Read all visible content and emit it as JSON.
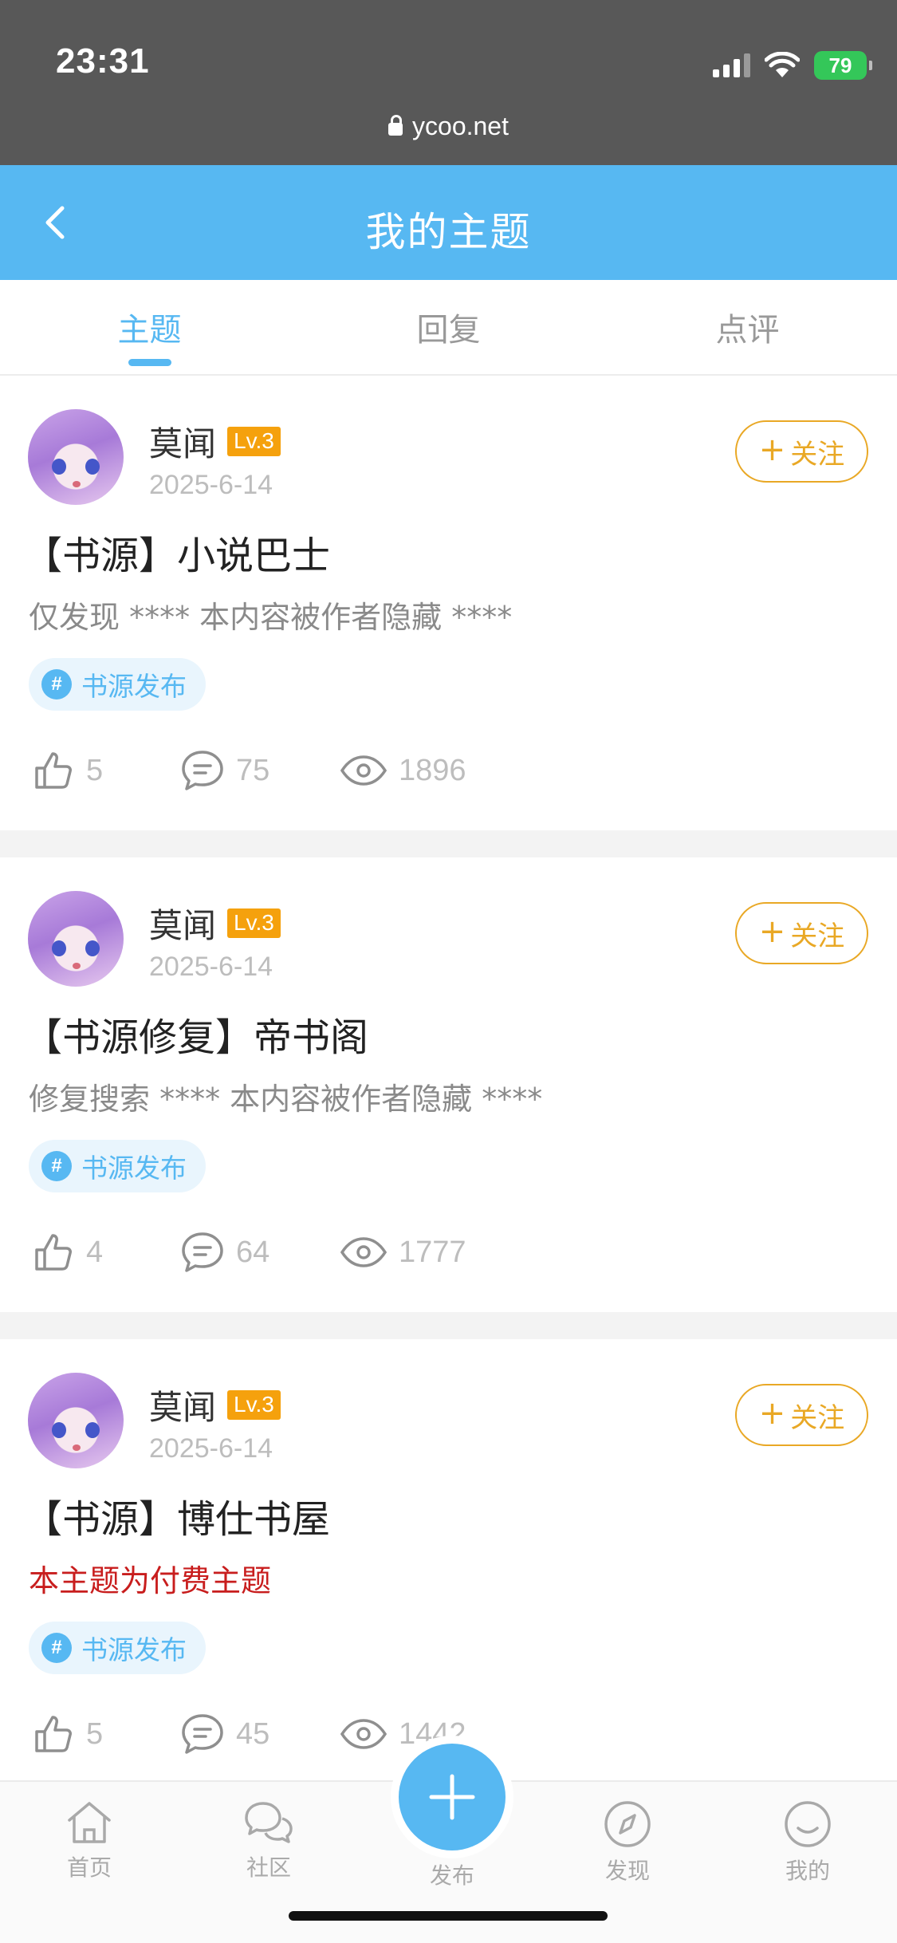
{
  "status_bar": {
    "time": "23:31",
    "battery": "79",
    "url": "ycoo.net"
  },
  "header": {
    "title": "我的主题"
  },
  "tabs": [
    {
      "label": "主题",
      "active": true
    },
    {
      "label": "回复",
      "active": false
    },
    {
      "label": "点评",
      "active": false
    }
  ],
  "posts": [
    {
      "author": "莫闻",
      "level": "Lv.3",
      "date": "2025-6-14",
      "follow_label": "关注",
      "title": "【书源】小说巴士",
      "excerpt": "仅发现 **** 本内容被作者隐藏 ****",
      "excerpt_paid": false,
      "tag": "书源发布",
      "likes": "5",
      "comments": "75",
      "views": "1896"
    },
    {
      "author": "莫闻",
      "level": "Lv.3",
      "date": "2025-6-14",
      "follow_label": "关注",
      "title": "【书源修复】帝书阁",
      "excerpt": "修复搜索 **** 本内容被作者隐藏 ****",
      "excerpt_paid": false,
      "tag": "书源发布",
      "likes": "4",
      "comments": "64",
      "views": "1777"
    },
    {
      "author": "莫闻",
      "level": "Lv.3",
      "date": "2025-6-14",
      "follow_label": "关注",
      "title": "【书源】博仕书屋",
      "excerpt": "本主题为付费主题",
      "excerpt_paid": true,
      "tag": "书源发布",
      "likes": "5",
      "comments": "45",
      "views": "1442"
    }
  ],
  "bottom_nav": {
    "home": "首页",
    "community": "社区",
    "publish": "发布",
    "discover": "发现",
    "mine": "我的"
  },
  "colors": {
    "accent": "#57b8f2",
    "follow": "#e9a825",
    "level_badge": "#f5a10d",
    "paid_text": "#c81d1d"
  }
}
